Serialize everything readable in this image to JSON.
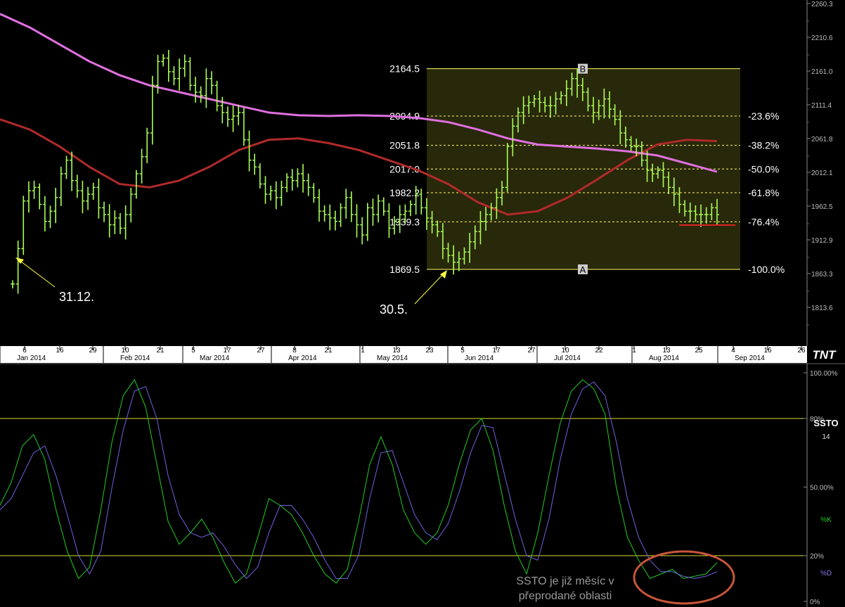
{
  "chart_data": [
    {
      "type": "bar",
      "style": "ohlc",
      "price_axis": {
        "ticks": [
          "2260.3",
          "2210.6",
          "2161.0",
          "2111.4",
          "2061.8",
          "2012.1",
          "1962.5",
          "1912.9",
          "1863.3",
          "1813.6"
        ],
        "range": [
          1775.0,
          2260.3
        ]
      },
      "date_axis": {
        "day_ticks": [
          "6",
          "16",
          "29",
          "10",
          "21",
          "5",
          "17",
          "27",
          "8",
          "21",
          "1",
          "13",
          "23",
          "5",
          "17",
          "27",
          "10",
          "22",
          "1",
          "13",
          "25",
          "4",
          "16",
          "26"
        ],
        "month_labels": [
          "Jan 2014",
          "Feb 2014",
          "Mar 2014",
          "Apr 2014",
          "May 2014",
          "Jun 2014",
          "Jul 2014",
          "Aug 2014",
          "Sep 2014"
        ],
        "logo": "TNT"
      },
      "series": [
        {
          "kind": "price",
          "color": "#aaff55",
          "closes": [
            1848,
            1900,
            1970,
            1985,
            1990,
            1965,
            1940,
            1955,
            1975,
            2010,
            2030,
            2000,
            1985,
            1970,
            1980,
            1990,
            1960,
            1950,
            1935,
            1945,
            1930,
            1950,
            1980,
            2010,
            2035,
            2070,
            2140,
            2175,
            2180,
            2160,
            2150,
            2165,
            2175,
            2140,
            2130,
            2125,
            2150,
            2140,
            2110,
            2100,
            2090,
            2095,
            2100,
            2060,
            2030,
            2020,
            1995,
            1980,
            1985,
            1975,
            1990,
            2005,
            2000,
            2010,
            2000,
            1990,
            1975,
            1955,
            1950,
            1945,
            1940,
            1960,
            1975,
            1950,
            1935,
            1920,
            1960,
            1950,
            1970,
            1955,
            1930,
            1940,
            1950,
            1955,
            1965,
            1980,
            1960,
            1945,
            1935,
            1925,
            1900,
            1890,
            1880,
            1885,
            1895,
            1910,
            1925,
            1940,
            1950,
            1960,
            1975,
            1990,
            2050,
            2080,
            2100,
            2110,
            2115,
            2120,
            2115,
            2110,
            2110,
            2120,
            2125,
            2135,
            2150,
            2140,
            2130,
            2110,
            2100,
            2110,
            2120,
            2105,
            2090,
            2070,
            2060,
            2050,
            2050,
            2030,
            2015,
            2010,
            2015,
            2005,
            1990,
            1980,
            1965,
            1955,
            1955,
            1950,
            1950,
            1950,
            1960,
            1950
          ]
        },
        {
          "kind": "moving_average",
          "color": "#b02a2a",
          "values": [
            2090,
            2075,
            2050,
            2020,
            1995,
            1990,
            2000,
            2020,
            2045,
            2060,
            2062,
            2055,
            2045,
            2030,
            2015,
            1995,
            1968,
            1950,
            1955,
            1975,
            2002,
            2030,
            2053,
            2060,
            2058
          ]
        },
        {
          "kind": "moving_average",
          "color": "#e070e0",
          "values": [
            2245,
            2225,
            2200,
            2175,
            2155,
            2140,
            2130,
            2120,
            2110,
            2100,
            2096,
            2095,
            2096,
            2095,
            2092,
            2086,
            2075,
            2062,
            2053,
            2050,
            2047,
            2043,
            2037,
            2025,
            2013
          ]
        }
      ],
      "fibonacci": {
        "point_a": "A",
        "point_b": "B",
        "levels": [
          {
            "price": "2164.5",
            "pct": ""
          },
          {
            "price": "2094.9",
            "pct": "-23.6%"
          },
          {
            "price": "2051.8",
            "pct": "-38.2%"
          },
          {
            "price": "2017.0",
            "pct": "-50.0%"
          },
          {
            "price": "1982.2",
            "pct": "-61.8%"
          },
          {
            "price": "1939.3",
            "pct": "-76.4%"
          },
          {
            "price": "1869.5",
            "pct": "-100.0%"
          }
        ]
      },
      "annotations": [
        "31.12.",
        "30.5."
      ]
    },
    {
      "type": "line",
      "indicator_name": "SSTO",
      "period": "14",
      "y_axis_ticks": [
        "100.00%",
        "80%",
        "50.00%",
        "20%",
        "0%"
      ],
      "levels": [
        80,
        20
      ],
      "range": [
        0,
        100
      ],
      "series": [
        {
          "name": "%K",
          "color": "#22cc22",
          "values": [
            42,
            52,
            68,
            73,
            62,
            40,
            22,
            10,
            15,
            40,
            70,
            90,
            97,
            85,
            60,
            35,
            25,
            30,
            36,
            28,
            17,
            8,
            12,
            28,
            45,
            42,
            38,
            30,
            20,
            12,
            8,
            14,
            35,
            60,
            72,
            60,
            40,
            30,
            25,
            30,
            42,
            60,
            75,
            80,
            66,
            42,
            22,
            12,
            30,
            55,
            78,
            92,
            97,
            93,
            82,
            50,
            28,
            18,
            10,
            12,
            14,
            10,
            11,
            12,
            17
          ]
        },
        {
          "name": "%D",
          "color": "#7060e0",
          "values": [
            40,
            45,
            55,
            65,
            68,
            55,
            38,
            20,
            12,
            22,
            50,
            75,
            92,
            94,
            80,
            55,
            38,
            30,
            28,
            30,
            24,
            16,
            10,
            15,
            30,
            42,
            42,
            36,
            28,
            18,
            10,
            10,
            20,
            45,
            65,
            66,
            52,
            38,
            30,
            27,
            34,
            48,
            65,
            77,
            76,
            56,
            36,
            20,
            18,
            36,
            62,
            82,
            93,
            96,
            90,
            70,
            45,
            28,
            18,
            13,
            13,
            11,
            10,
            11,
            13
          ]
        }
      ],
      "annotation": [
        "SSTO je již měsíc v",
        "přeprodané oblasti"
      ]
    }
  ]
}
